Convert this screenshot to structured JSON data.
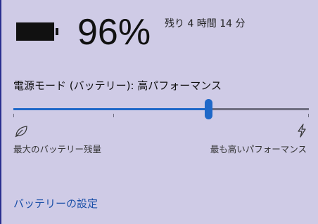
{
  "battery": {
    "percent_text": "96%",
    "level": 0.96,
    "remaining_text": "残り 4 時間 14 分"
  },
  "power_mode": {
    "label": "電源モード (バッテリー): 高パフォーマンス",
    "slider_value": 0.66,
    "left_label": "最大のバッテリー残量",
    "right_label": "最も高いパフォーマンス",
    "left_icon": "leaf-icon",
    "right_icon": "lightning-bolt-icon"
  },
  "footer": {
    "settings_link": "バッテリーの設定"
  },
  "colors": {
    "background": "#cfcbe6",
    "accent": "#1f68c8",
    "track": "#6e6d80",
    "link": "#1a4fa8",
    "left_border": "#2a2f8f"
  }
}
